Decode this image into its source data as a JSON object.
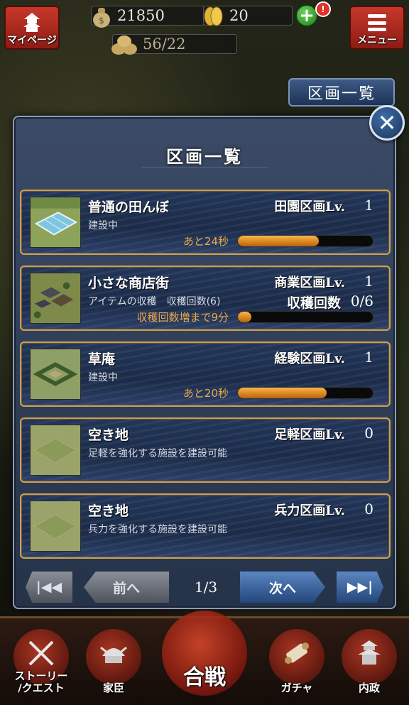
{
  "hud": {
    "mypage_label": "マイページ",
    "menu_label": "メニュー",
    "gold": "21850",
    "coins": "20",
    "rice": "56/22",
    "notification_count": "!"
  },
  "top_list_button": "区画一覧",
  "dialog": {
    "title": "区画一覧",
    "plots": [
      {
        "name": "普通の田んぼ",
        "subtitle": "建設中",
        "type_label": "田園区画Lv.",
        "level": "1",
        "timer_text": "あと24秒",
        "progress": 0.6
      },
      {
        "name": "小さな商店街",
        "subtitle": "アイテムの収穫　収穫回数(6)",
        "type_label": "商業区画Lv.",
        "level": "1",
        "harvest_label": "収穫回数",
        "harvest_value": "0/6",
        "timer_text": "収穫回数増まで9分",
        "progress": 0.1
      },
      {
        "name": "草庵",
        "subtitle": "建設中",
        "type_label": "経験区画Lv.",
        "level": "1",
        "timer_text": "あと20秒",
        "progress": 0.66
      },
      {
        "name": "空き地",
        "subtitle": "足軽を強化する施設を建設可能",
        "type_label": "足軽区画Lv.",
        "level": "0"
      },
      {
        "name": "空き地",
        "subtitle": "兵力を強化する施設を建設可能",
        "type_label": "兵力区画Lv.",
        "level": "0"
      }
    ],
    "pagination": {
      "first_label": "|◀◀",
      "prev_label": "前へ",
      "page": "1/3",
      "next_label": "次へ",
      "last_label": "▶▶|"
    }
  },
  "bottom_nav": {
    "story_label": "ストーリー\n/クエスト",
    "retainer_label": "家臣",
    "battle_label": "合戦",
    "gacha_label": "ガチャ",
    "domestic_label": "内政"
  },
  "colors": {
    "accent_gold": "#c9a15c",
    "progress_orange": "#e8962c",
    "timer_text": "#e8a84a",
    "hud_red": "#c8372a",
    "next_blue": "#3b66a8"
  }
}
